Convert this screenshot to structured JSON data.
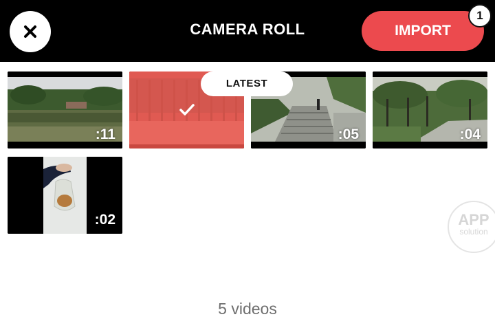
{
  "header": {
    "title": "CAMERA ROLL",
    "close_icon": "close-icon",
    "import_label": "IMPORT",
    "selected_count": "1",
    "accent_color": "#ec4a4e"
  },
  "grid": {
    "latest_label": "LATEST",
    "videos": [
      {
        "duration": ":11",
        "scene": "lake with trees",
        "selected": false
      },
      {
        "duration": "",
        "scene": "tree-lined park",
        "selected": true,
        "selected_icon": "checkmark-icon"
      },
      {
        "duration": ":05",
        "scene": "stone stairs in park",
        "selected": false
      },
      {
        "duration": ":04",
        "scene": "park path with trees",
        "selected": false
      },
      {
        "duration": ":02",
        "scene": "hand holding plastic bag",
        "selected": false
      }
    ]
  },
  "watermark": {
    "line1": "APP",
    "line2": "solution"
  },
  "footer": {
    "count_text": "5 videos"
  }
}
